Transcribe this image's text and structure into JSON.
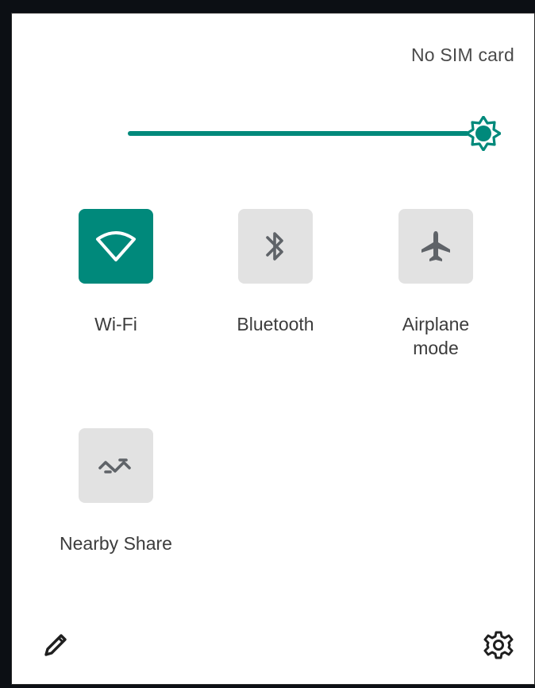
{
  "status": {
    "sim": "No SIM card"
  },
  "brightness": {
    "level": 1.0,
    "accent": "#00897b"
  },
  "tiles": [
    {
      "label": "Wi-Fi",
      "icon": "wifi-icon",
      "active": true
    },
    {
      "label": "Bluetooth",
      "icon": "bluetooth-icon",
      "active": false
    },
    {
      "label": "Airplane\nmode",
      "icon": "airplane-icon",
      "active": false
    },
    {
      "label": "Nearby Share",
      "icon": "nearby-share-icon",
      "active": false
    }
  ],
  "footer": {
    "edit_icon": "pencil-icon",
    "settings_icon": "gear-icon"
  },
  "colors": {
    "active_tile": "#00897b",
    "inactive_tile": "#e2e2e2",
    "icon_inactive": "#5f6368"
  }
}
